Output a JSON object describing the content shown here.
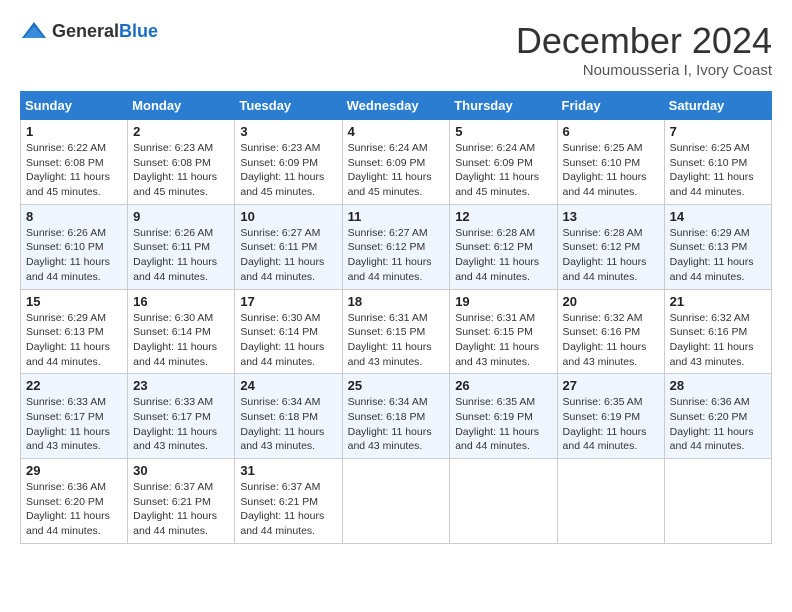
{
  "header": {
    "logo_general": "General",
    "logo_blue": "Blue",
    "month_title": "December 2024",
    "location": "Noumousseria I, Ivory Coast"
  },
  "calendar": {
    "days_of_week": [
      "Sunday",
      "Monday",
      "Tuesday",
      "Wednesday",
      "Thursday",
      "Friday",
      "Saturday"
    ],
    "weeks": [
      [
        {
          "day": "1",
          "sunrise": "6:22 AM",
          "sunset": "6:08 PM",
          "daylight": "11 hours and 45 minutes."
        },
        {
          "day": "2",
          "sunrise": "6:23 AM",
          "sunset": "6:08 PM",
          "daylight": "11 hours and 45 minutes."
        },
        {
          "day": "3",
          "sunrise": "6:23 AM",
          "sunset": "6:09 PM",
          "daylight": "11 hours and 45 minutes."
        },
        {
          "day": "4",
          "sunrise": "6:24 AM",
          "sunset": "6:09 PM",
          "daylight": "11 hours and 45 minutes."
        },
        {
          "day": "5",
          "sunrise": "6:24 AM",
          "sunset": "6:09 PM",
          "daylight": "11 hours and 45 minutes."
        },
        {
          "day": "6",
          "sunrise": "6:25 AM",
          "sunset": "6:10 PM",
          "daylight": "11 hours and 44 minutes."
        },
        {
          "day": "7",
          "sunrise": "6:25 AM",
          "sunset": "6:10 PM",
          "daylight": "11 hours and 44 minutes."
        }
      ],
      [
        {
          "day": "8",
          "sunrise": "6:26 AM",
          "sunset": "6:10 PM",
          "daylight": "11 hours and 44 minutes."
        },
        {
          "day": "9",
          "sunrise": "6:26 AM",
          "sunset": "6:11 PM",
          "daylight": "11 hours and 44 minutes."
        },
        {
          "day": "10",
          "sunrise": "6:27 AM",
          "sunset": "6:11 PM",
          "daylight": "11 hours and 44 minutes."
        },
        {
          "day": "11",
          "sunrise": "6:27 AM",
          "sunset": "6:12 PM",
          "daylight": "11 hours and 44 minutes."
        },
        {
          "day": "12",
          "sunrise": "6:28 AM",
          "sunset": "6:12 PM",
          "daylight": "11 hours and 44 minutes."
        },
        {
          "day": "13",
          "sunrise": "6:28 AM",
          "sunset": "6:12 PM",
          "daylight": "11 hours and 44 minutes."
        },
        {
          "day": "14",
          "sunrise": "6:29 AM",
          "sunset": "6:13 PM",
          "daylight": "11 hours and 44 minutes."
        }
      ],
      [
        {
          "day": "15",
          "sunrise": "6:29 AM",
          "sunset": "6:13 PM",
          "daylight": "11 hours and 44 minutes."
        },
        {
          "day": "16",
          "sunrise": "6:30 AM",
          "sunset": "6:14 PM",
          "daylight": "11 hours and 44 minutes."
        },
        {
          "day": "17",
          "sunrise": "6:30 AM",
          "sunset": "6:14 PM",
          "daylight": "11 hours and 44 minutes."
        },
        {
          "day": "18",
          "sunrise": "6:31 AM",
          "sunset": "6:15 PM",
          "daylight": "11 hours and 43 minutes."
        },
        {
          "day": "19",
          "sunrise": "6:31 AM",
          "sunset": "6:15 PM",
          "daylight": "11 hours and 43 minutes."
        },
        {
          "day": "20",
          "sunrise": "6:32 AM",
          "sunset": "6:16 PM",
          "daylight": "11 hours and 43 minutes."
        },
        {
          "day": "21",
          "sunrise": "6:32 AM",
          "sunset": "6:16 PM",
          "daylight": "11 hours and 43 minutes."
        }
      ],
      [
        {
          "day": "22",
          "sunrise": "6:33 AM",
          "sunset": "6:17 PM",
          "daylight": "11 hours and 43 minutes."
        },
        {
          "day": "23",
          "sunrise": "6:33 AM",
          "sunset": "6:17 PM",
          "daylight": "11 hours and 43 minutes."
        },
        {
          "day": "24",
          "sunrise": "6:34 AM",
          "sunset": "6:18 PM",
          "daylight": "11 hours and 43 minutes."
        },
        {
          "day": "25",
          "sunrise": "6:34 AM",
          "sunset": "6:18 PM",
          "daylight": "11 hours and 43 minutes."
        },
        {
          "day": "26",
          "sunrise": "6:35 AM",
          "sunset": "6:19 PM",
          "daylight": "11 hours and 44 minutes."
        },
        {
          "day": "27",
          "sunrise": "6:35 AM",
          "sunset": "6:19 PM",
          "daylight": "11 hours and 44 minutes."
        },
        {
          "day": "28",
          "sunrise": "6:36 AM",
          "sunset": "6:20 PM",
          "daylight": "11 hours and 44 minutes."
        }
      ],
      [
        {
          "day": "29",
          "sunrise": "6:36 AM",
          "sunset": "6:20 PM",
          "daylight": "11 hours and 44 minutes."
        },
        {
          "day": "30",
          "sunrise": "6:37 AM",
          "sunset": "6:21 PM",
          "daylight": "11 hours and 44 minutes."
        },
        {
          "day": "31",
          "sunrise": "6:37 AM",
          "sunset": "6:21 PM",
          "daylight": "11 hours and 44 minutes."
        },
        null,
        null,
        null,
        null
      ]
    ],
    "labels": {
      "sunrise": "Sunrise:",
      "sunset": "Sunset:",
      "daylight": "Daylight:"
    }
  }
}
